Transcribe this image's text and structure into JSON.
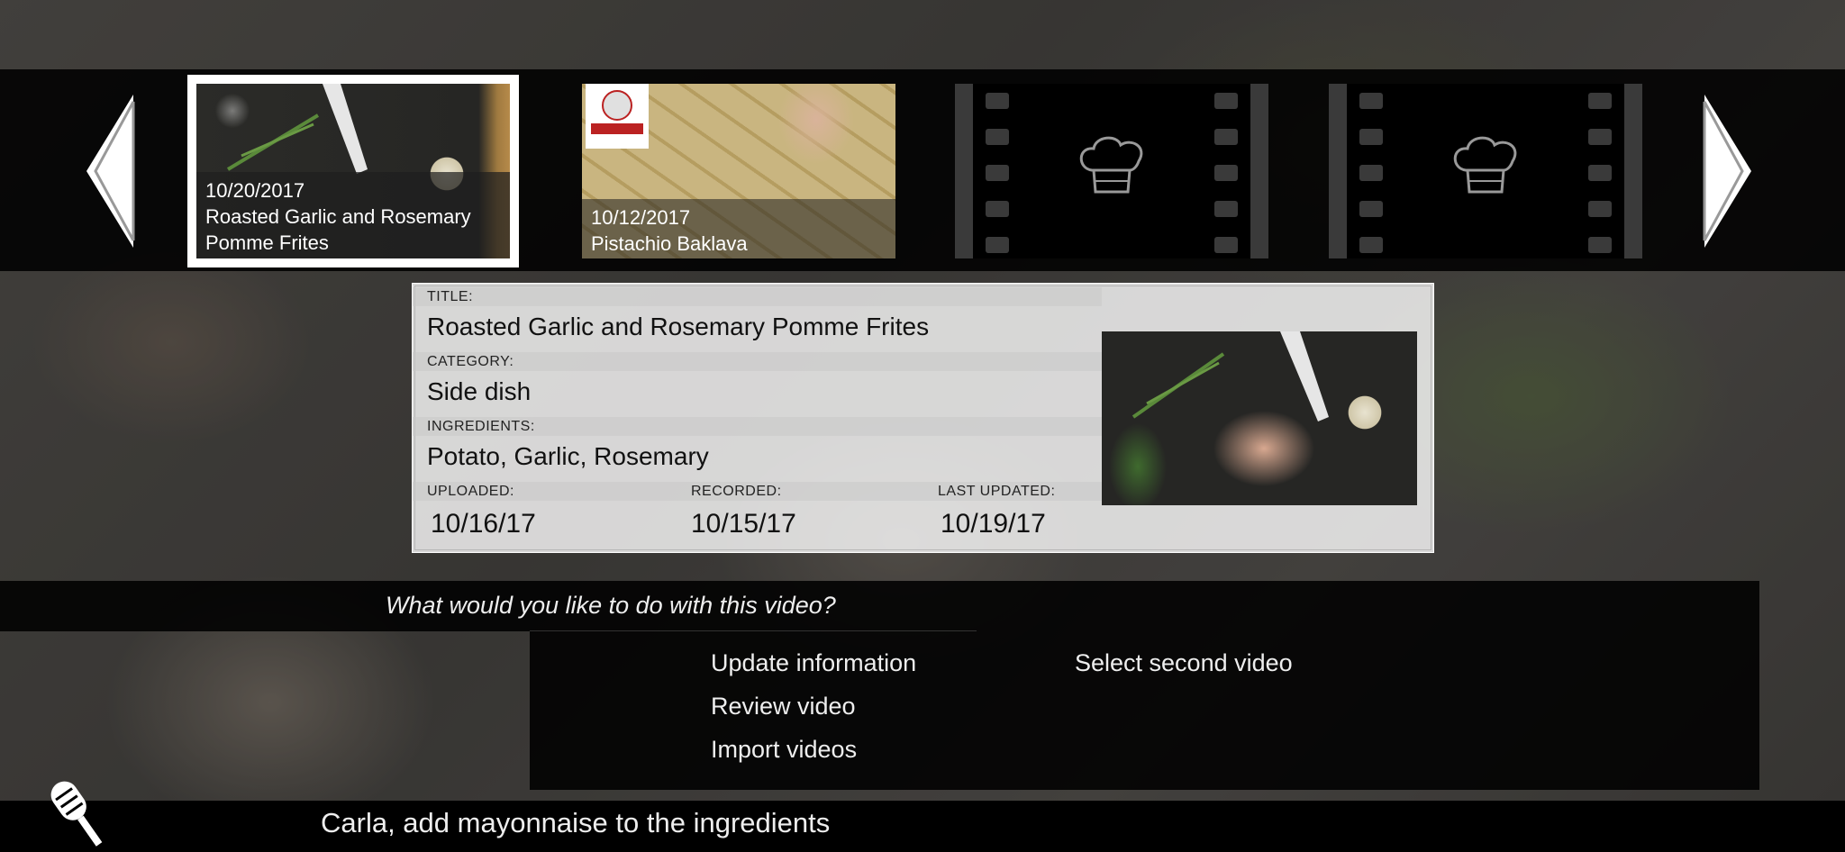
{
  "carousel": {
    "items": [
      {
        "date": "10/20/2017",
        "title": "Roasted Garlic and Rosemary Pomme Frites",
        "selected": true
      },
      {
        "date": "10/12/2017",
        "title": "Pistachio Baklava",
        "selected": false
      },
      {
        "date": "",
        "title": "",
        "selected": false
      },
      {
        "date": "",
        "title": "",
        "selected": false
      }
    ]
  },
  "details": {
    "title_label": "TITLE:",
    "title": "Roasted Garlic and Rosemary Pomme Frites",
    "category_label": "CATEGORY:",
    "category": "Side dish",
    "ingredients_label": "INGREDIENTS:",
    "ingredients": "Potato, Garlic, Rosemary",
    "uploaded_label": "UPLOADED:",
    "uploaded": "10/16/17",
    "recorded_label": "RECORDED:",
    "recorded": "10/15/17",
    "last_updated_label": "LAST UPDATED:",
    "last_updated": "10/19/17"
  },
  "actions": {
    "prompt": "What would you like to do with this video?",
    "options": [
      "Update information",
      "Review video",
      "Import videos",
      "Select second video"
    ]
  },
  "voice": {
    "command": "Carla, add mayonnaise to the ingredients"
  },
  "icons": {
    "prev": "chevron-left-icon",
    "next": "chevron-right-icon",
    "placeholder": "chef-hat-icon",
    "mic": "microphone-icon"
  }
}
